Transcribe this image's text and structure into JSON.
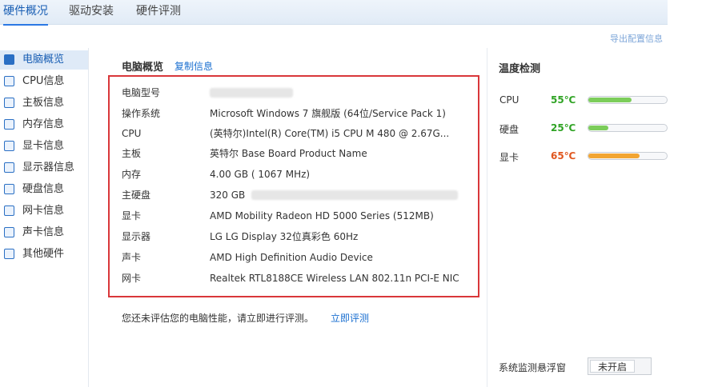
{
  "tabs": [
    {
      "label": "硬件概况",
      "active": true
    },
    {
      "label": "驱动安装",
      "active": false
    },
    {
      "label": "硬件评测",
      "active": false
    }
  ],
  "export_link": "导出配置信息",
  "sidebar": {
    "items": [
      {
        "label": "电脑概览",
        "icon": "computer-icon",
        "active": true
      },
      {
        "label": "CPU信息",
        "icon": "cpu-icon"
      },
      {
        "label": "主板信息",
        "icon": "motherboard-icon"
      },
      {
        "label": "内存信息",
        "icon": "memory-icon"
      },
      {
        "label": "显卡信息",
        "icon": "graphics-card-icon"
      },
      {
        "label": "显示器信息",
        "icon": "monitor-icon"
      },
      {
        "label": "硬盘信息",
        "icon": "hard-disk-icon"
      },
      {
        "label": "网卡信息",
        "icon": "network-card-icon"
      },
      {
        "label": "声卡信息",
        "icon": "sound-card-icon"
      },
      {
        "label": "其他硬件",
        "icon": "other-hardware-icon"
      }
    ]
  },
  "overview": {
    "title": "电脑概览",
    "copy_label": "复制信息",
    "rows": [
      {
        "label": "电脑型号",
        "value": ""
      },
      {
        "label": "操作系统",
        "value": "Microsoft Windows 7 旗舰版 (64位/Service Pack 1)"
      },
      {
        "label": "CPU",
        "value": "(英特尔)Intel(R) Core(TM) i5 CPU      M 480  @ 2.67G..."
      },
      {
        "label": "主板",
        "value": "英特尔 Base Board Product Name"
      },
      {
        "label": "内存",
        "value": "4.00 GB (   1067 MHz)"
      },
      {
        "label": "主硬盘",
        "value": "320 GB"
      },
      {
        "label": "显卡",
        "value": "AMD Mobility Radeon HD 5000 Series (512MB)"
      },
      {
        "label": "显示器",
        "value": "LG LG Display 32位真彩色 60Hz"
      },
      {
        "label": "声卡",
        "value": "AMD High Definition Audio Device"
      },
      {
        "label": "网卡",
        "value": "Realtek RTL8188CE Wireless LAN 802.11n PCI-E NIC"
      }
    ],
    "status_text": "您还未评估您的电脑性能，请立即进行评测。",
    "eval_link": "立即评测"
  },
  "temperature": {
    "title": "温度检测",
    "items": [
      {
        "name": "CPU",
        "value": "55℃",
        "level": 0.55,
        "color": "#2fa324",
        "fill": "#7ccd5a"
      },
      {
        "name": "硬盘",
        "value": "25℃",
        "level": 0.25,
        "color": "#2fa324",
        "fill": "#7ccd5a"
      },
      {
        "name": "显卡",
        "value": "65℃",
        "level": 0.65,
        "color": "#e0561e",
        "fill": "#f2a532"
      }
    ]
  },
  "monitor": {
    "label": "系统监测悬浮窗",
    "toggle_label": "未开启"
  },
  "colors": {
    "accent": "#2b78e4",
    "link": "#1a6fd0",
    "highlight_border": "#d9373a"
  }
}
